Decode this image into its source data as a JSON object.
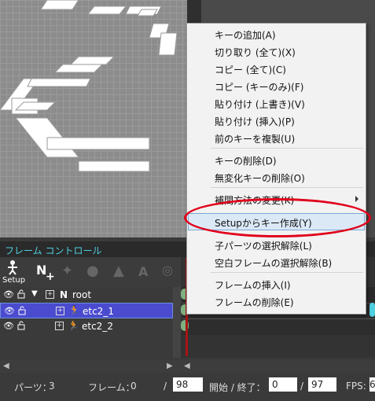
{
  "menu": {
    "items": [
      {
        "label": "キーの追加(A)"
      },
      {
        "label": "切り取り (全て)(X)"
      },
      {
        "label": "コピー (全て)(C)"
      },
      {
        "label": "コピー (キーのみ)(F)"
      },
      {
        "label": "貼り付け (上書き)(V)"
      },
      {
        "label": "貼り付け (挿入)(P)"
      },
      {
        "label": "前のキーを複製(U)"
      },
      {
        "label": "キーの削除(D)"
      },
      {
        "label": "無変化キーの削除(O)"
      },
      {
        "label": "補間方法の変更(K)"
      },
      {
        "label": "Setupからキー作成(Y)"
      },
      {
        "label": "子パーツの選択解除(L)"
      },
      {
        "label": "空白フレームの選択解除(B)"
      },
      {
        "label": "フレームの挿入(I)"
      },
      {
        "label": "フレームの削除(E)"
      }
    ]
  },
  "frame_control": {
    "title": "フレーム コントロール"
  },
  "toolbar": {
    "setup_label": "Setup",
    "n_label": "N"
  },
  "tree": {
    "rows": [
      {
        "label": "root",
        "type_glyph": "N"
      },
      {
        "label": "etc2_1"
      },
      {
        "label": "etc2_2"
      }
    ]
  },
  "status": {
    "parts_label": "パーツ：",
    "parts_value": "3",
    "frame_label": "フレーム：",
    "frame_value": "0",
    "slash1": "/",
    "frame_total": "98",
    "start_end_label": "開始 / 終了：",
    "start_value": "0",
    "slash2": "/",
    "end_value": "97",
    "fps_label": "FPS:",
    "fps_value": "6"
  },
  "colors": {
    "highlight": "#dbe9f7",
    "annotation": "#e0001a",
    "title_accent": "#4fd0e0"
  }
}
